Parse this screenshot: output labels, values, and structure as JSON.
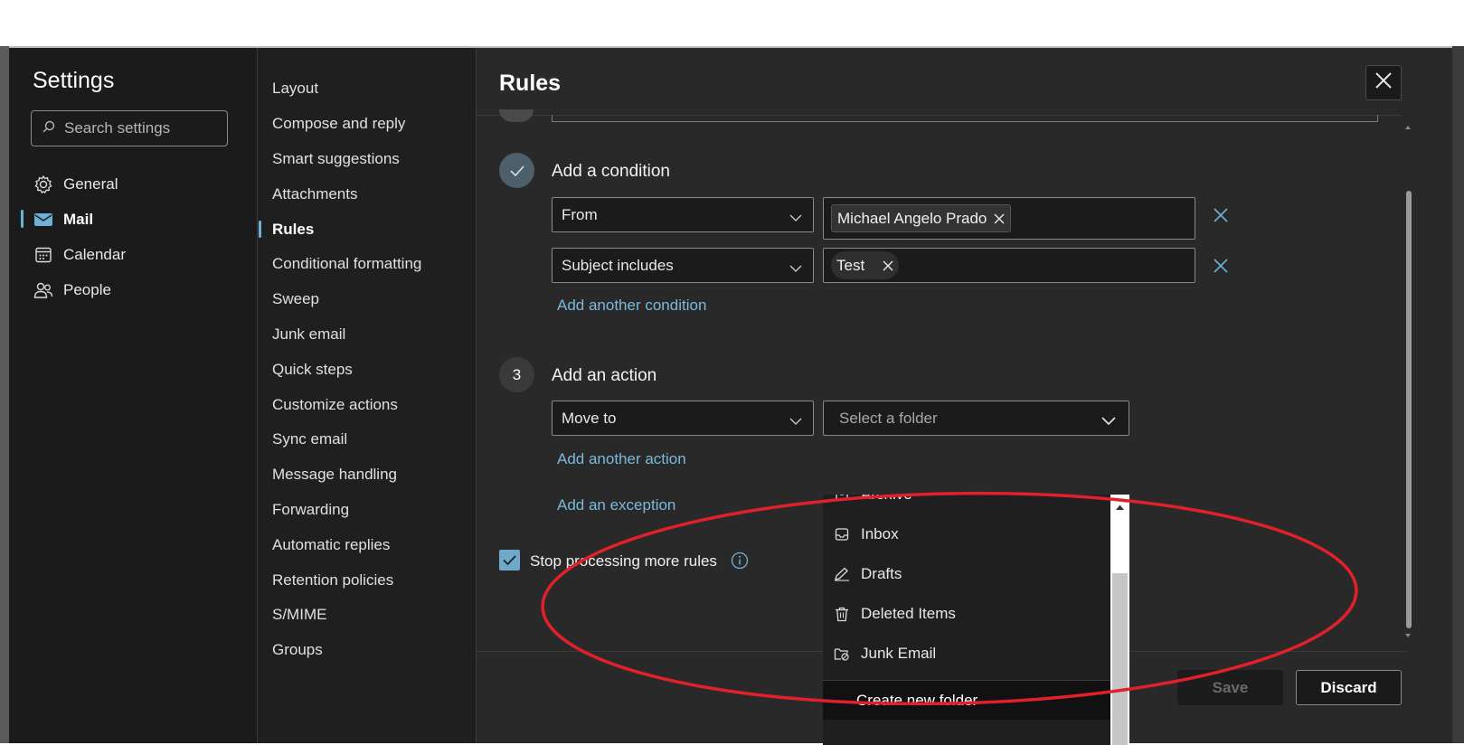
{
  "settings": {
    "title": "Settings",
    "search_placeholder": "Search settings",
    "categories": [
      {
        "label": "General",
        "icon": "gear-icon"
      },
      {
        "label": "Mail",
        "icon": "mail-icon",
        "active": true
      },
      {
        "label": "Calendar",
        "icon": "calendar-icon"
      },
      {
        "label": "People",
        "icon": "people-icon"
      }
    ]
  },
  "mail_nav": {
    "items": [
      "Layout",
      "Compose and reply",
      "Smart suggestions",
      "Attachments",
      "Rules",
      "Conditional formatting",
      "Sweep",
      "Junk email",
      "Quick steps",
      "Customize actions",
      "Sync email",
      "Message handling",
      "Forwarding",
      "Automatic replies",
      "Retention policies",
      "S/MIME",
      "Groups"
    ],
    "active": "Rules"
  },
  "rules": {
    "title": "Rules",
    "condition": {
      "label": "Add a condition",
      "rows": [
        {
          "field": "From",
          "value": "Michael Angelo Prado"
        },
        {
          "field": "Subject includes",
          "value": "Test"
        }
      ],
      "add_link": "Add another condition"
    },
    "action": {
      "step": "3",
      "label": "Add an action",
      "field": "Move to",
      "folder_placeholder": "Select a folder",
      "add_link": "Add another action"
    },
    "exception_link": "Add an exception",
    "stop_processing": {
      "label": "Stop processing more rules",
      "checked": true
    },
    "save_label": "Save",
    "discard_label": "Discard"
  },
  "folder_menu": {
    "items": [
      {
        "label": "Archive",
        "icon": "archive-icon"
      },
      {
        "label": "Inbox",
        "icon": "inbox-icon"
      },
      {
        "label": "Drafts",
        "icon": "drafts-icon"
      },
      {
        "label": "Deleted Items",
        "icon": "trash-icon"
      },
      {
        "label": "Junk Email",
        "icon": "junk-folder-icon"
      }
    ],
    "create_label": "Create new folder"
  },
  "colors": {
    "accent": "#6fb1d6",
    "annotation": "#e0202a"
  }
}
